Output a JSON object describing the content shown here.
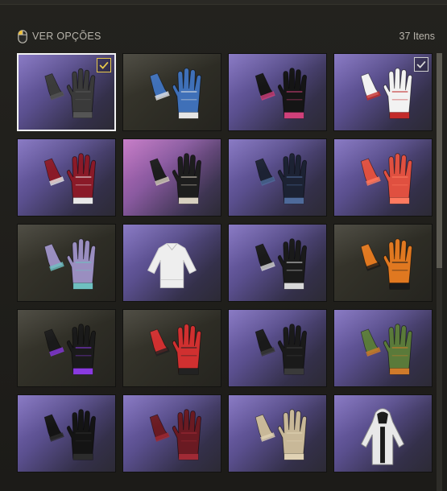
{
  "header": {
    "view_options": "VER OPÇÕES",
    "item_count": "37 Itens"
  },
  "colors": {
    "selection_border": "#f2f2f2",
    "check_gold": "#e9c94a",
    "check_white": "#d8d8d8",
    "tile_purple": "#6e5fae",
    "tile_pink": "#b468b8",
    "tile_olive": "#35342b"
  },
  "scroll": {
    "visible_fraction": 0.49
  },
  "items": [
    {
      "bg": "purple",
      "style": "dark-gray-fingerless",
      "selected": true,
      "checked": true,
      "check": "gold",
      "c1": "#3a3a3a",
      "c2": "#555555"
    },
    {
      "bg": "olive",
      "style": "blue-white-tactical",
      "selected": false,
      "checked": false,
      "c1": "#3f70b8",
      "c2": "#e5e5e5"
    },
    {
      "bg": "purple",
      "style": "black-long-pink-trim",
      "selected": false,
      "checked": false,
      "c1": "#151515",
      "c2": "#d0407a"
    },
    {
      "bg": "purple",
      "style": "white-lady-red-nails",
      "selected": false,
      "checked": true,
      "check": "white",
      "c1": "#f2f2f2",
      "c2": "#c22a2a"
    },
    {
      "bg": "purple",
      "style": "red-skeleton",
      "selected": false,
      "checked": false,
      "c1": "#8a1a28",
      "c2": "#e8e8e8"
    },
    {
      "bg": "pink",
      "style": "skeleton-bone",
      "selected": false,
      "checked": false,
      "c1": "#1d1d1d",
      "c2": "#d8d0c0"
    },
    {
      "bg": "purple",
      "style": "black-blue-leather",
      "selected": false,
      "checked": false,
      "c1": "#1c2233",
      "c2": "#4e6a9a"
    },
    {
      "bg": "purple",
      "style": "coral-red",
      "selected": false,
      "checked": false,
      "c1": "#e05040",
      "c2": "#ff7a60"
    },
    {
      "bg": "olive",
      "style": "purple-teal-camo",
      "selected": false,
      "checked": false,
      "c1": "#9a8ec0",
      "c2": "#6ec0c0"
    },
    {
      "bg": "purple",
      "style": "white-shirt",
      "selected": false,
      "checked": false,
      "c1": "#eeeeee",
      "c2": "#cccccc"
    },
    {
      "bg": "purple",
      "style": "black-silver-knuckle",
      "selected": false,
      "checked": false,
      "c1": "#1a1a1a",
      "c2": "#d8d8d8"
    },
    {
      "bg": "olive",
      "style": "orange-black-moto",
      "selected": false,
      "checked": false,
      "c1": "#e07820",
      "c2": "#1a1a1a"
    },
    {
      "bg": "olive",
      "style": "purple-fingerless",
      "selected": false,
      "checked": false,
      "c1": "#1a1a1a",
      "c2": "#8a3ae0"
    },
    {
      "bg": "olive",
      "style": "red-black-racing",
      "selected": false,
      "checked": false,
      "c1": "#d03030",
      "c2": "#222222"
    },
    {
      "bg": "purple",
      "style": "black-fingerless",
      "selected": false,
      "checked": false,
      "c1": "#1a1a1a",
      "c2": "#3a3a3a"
    },
    {
      "bg": "purple",
      "style": "camo-green-orange",
      "selected": false,
      "checked": false,
      "c1": "#5a7a3a",
      "c2": "#d07a2a"
    },
    {
      "bg": "purple",
      "style": "black-plain",
      "selected": false,
      "checked": false,
      "c1": "#141414",
      "c2": "#2c2c2c"
    },
    {
      "bg": "purple",
      "style": "maroon-leather",
      "selected": false,
      "checked": false,
      "c1": "#6a1a22",
      "c2": "#a02a35"
    },
    {
      "bg": "purple",
      "style": "beige-lace",
      "selected": false,
      "checked": false,
      "c1": "#c8b898",
      "c2": "#e0d2b4"
    },
    {
      "bg": "purple",
      "style": "white-black-hoodie",
      "selected": false,
      "checked": false,
      "c1": "#e8e8e8",
      "c2": "#1a1a1a"
    }
  ]
}
